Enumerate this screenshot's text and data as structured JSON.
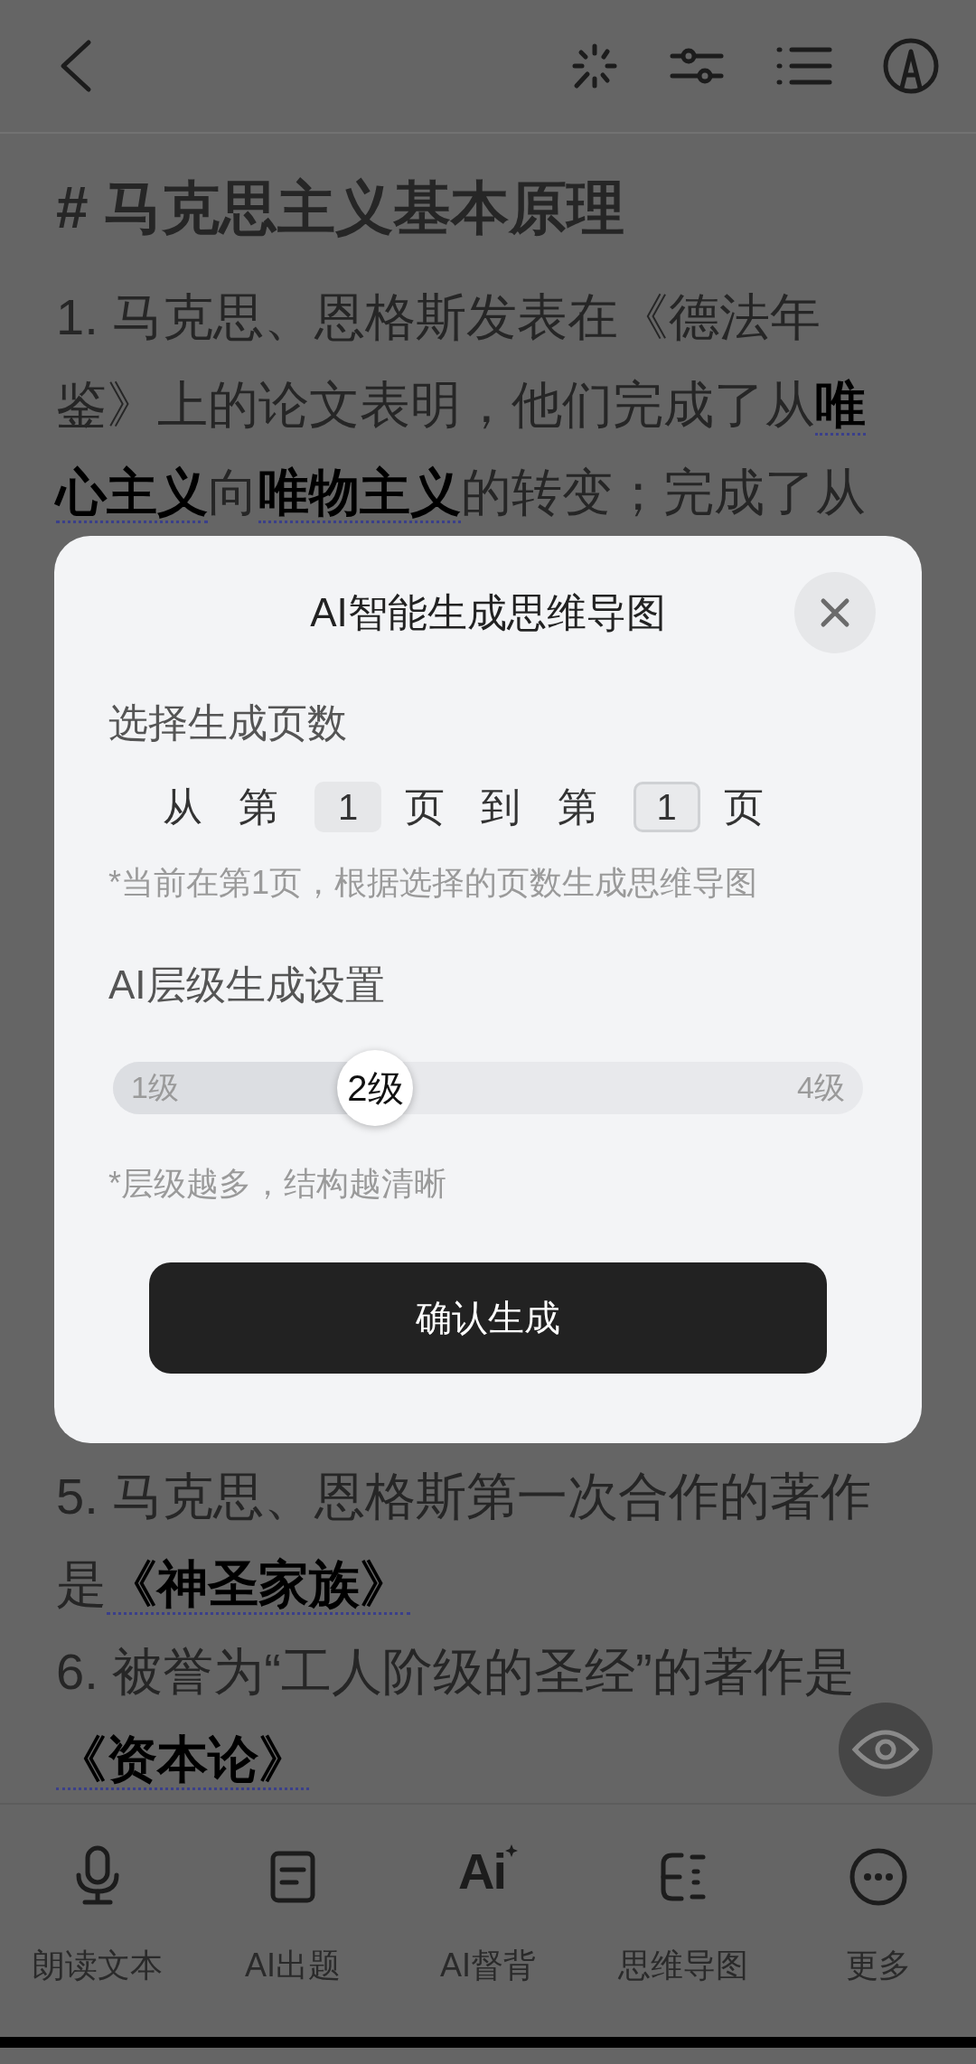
{
  "document": {
    "heading": "# 马克思主义基本原理",
    "paragraphs": [
      "1. 马克思、恩格斯发表在《德法年鉴》上的论文表明，他们完成了从**唯心主义**向**唯物主义**的转变；完成了从",
      "5. 马克思、恩格斯第一次合作的著作是**《神圣家族》**",
      "6. 被誉为“工人阶级的圣经”的著作是**《资本论》**"
    ]
  },
  "dialog": {
    "title": "AI智能生成思维导图",
    "page_section": {
      "title": "选择生成页数",
      "row": [
        {
          "kind": "text",
          "text": "从 第"
        },
        {
          "kind": "field",
          "value": "1",
          "focused": false
        },
        {
          "kind": "text",
          "text": "页 到 第"
        },
        {
          "kind": "field",
          "value": "1",
          "focused": true
        },
        {
          "kind": "text",
          "text": "页"
        }
      ],
      "hint": "*当前在第1页，根据选择的页数生成思维导图"
    },
    "level_section": {
      "title": "AI层级生成设置",
      "slider": {
        "min_label": "1级",
        "max_label": "4级",
        "value_label": "2级",
        "level": 0.333
      },
      "hint": "*层级越多，结构越清晰"
    },
    "confirm_button": "确认生成"
  },
  "bottom_nav": [
    {
      "label": "朗读文本"
    },
    {
      "label": "AI出题"
    },
    {
      "label": "AI督背",
      "icon_text": "Ai"
    },
    {
      "label": "思维导图"
    },
    {
      "label": "更多"
    }
  ]
}
